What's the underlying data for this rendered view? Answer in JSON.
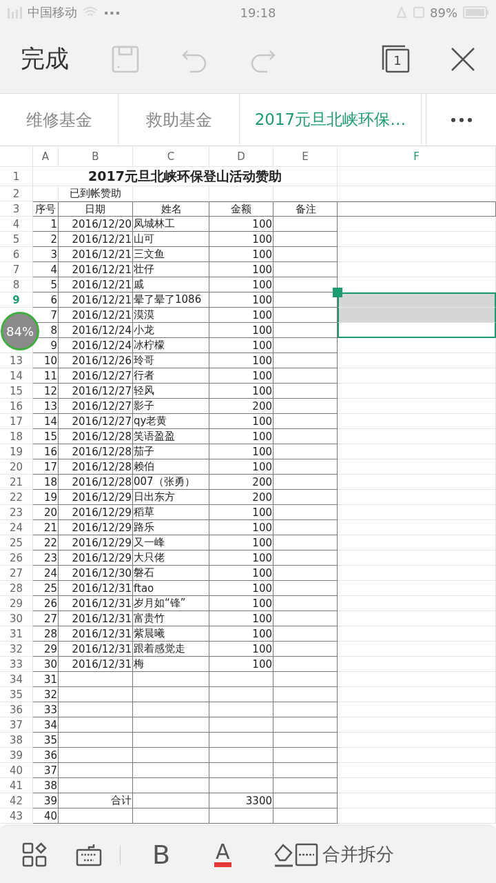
{
  "status_bar": {
    "carrier": "中国移动",
    "extra": "···",
    "time": "19:18",
    "battery": "89%"
  },
  "toolbar": {
    "done": "完成",
    "sheet_count": "1"
  },
  "sheet_tabs": [
    {
      "label": "维修基金",
      "selected": false
    },
    {
      "label": "救助基金",
      "selected": false
    },
    {
      "label": "2017元旦北峡环保…",
      "selected": true
    }
  ],
  "grid": {
    "columns": [
      {
        "label": "A",
        "selected": false
      },
      {
        "label": "B",
        "selected": false
      },
      {
        "label": "C",
        "selected": false
      },
      {
        "label": "D",
        "selected": false
      },
      {
        "label": "E",
        "selected": false
      },
      {
        "label": "F",
        "selected": true
      }
    ],
    "rows": [
      {
        "number": "1",
        "kind": "title",
        "selected": false,
        "in_selection": false,
        "title": "2017元旦北峡环保登山活动赞助"
      },
      {
        "number": "2",
        "kind": "note",
        "selected": false,
        "in_selection": false,
        "b": "已到帐赞助"
      },
      {
        "number": "3",
        "kind": "header",
        "selected": false,
        "in_selection": false,
        "a": "序号",
        "b": "日期",
        "c": "姓名",
        "d": "金额",
        "e": "备注"
      },
      {
        "number": "4",
        "kind": "data",
        "selected": false,
        "in_selection": false,
        "a": "1",
        "b": "2016/12/20",
        "c": "凤城林工",
        "d": "100"
      },
      {
        "number": "5",
        "kind": "data",
        "selected": false,
        "in_selection": false,
        "a": "2",
        "b": "2016/12/21",
        "c": "山可",
        "d": "100"
      },
      {
        "number": "6",
        "kind": "data",
        "selected": false,
        "in_selection": false,
        "a": "3",
        "b": "2016/12/21",
        "c": "三文鱼",
        "d": "100"
      },
      {
        "number": "7",
        "kind": "data",
        "selected": false,
        "in_selection": false,
        "a": "4",
        "b": "2016/12/21",
        "c": "壮仔",
        "d": "100"
      },
      {
        "number": "8",
        "kind": "data",
        "selected": false,
        "in_selection": false,
        "a": "5",
        "b": "2016/12/21",
        "c": "戚",
        "d": "100"
      },
      {
        "number": "9",
        "kind": "data",
        "selected": true,
        "in_selection": true,
        "a": "6",
        "b": "2016/12/21",
        "c": "晕了晕了1086",
        "d": "100"
      },
      {
        "kind": "data",
        "in_selection": true,
        "a": "7",
        "b": "2016/12/21",
        "c": "漠漠",
        "d": "100"
      },
      {
        "kind": "data",
        "in_selection": true,
        "a": "8",
        "b": "2016/12/24",
        "c": "小龙",
        "d": "100"
      },
      {
        "kind": "data",
        "in_selection": false,
        "a": "9",
        "b": "2016/12/24",
        "c": "冰柠檬",
        "d": "100"
      },
      {
        "number": "13",
        "kind": "data",
        "selected": false,
        "in_selection": false,
        "a": "10",
        "b": "2016/12/26",
        "c": "玲哥",
        "d": "100"
      },
      {
        "number": "14",
        "kind": "data",
        "selected": false,
        "in_selection": false,
        "a": "11",
        "b": "2016/12/27",
        "c": "行者",
        "d": "100"
      },
      {
        "number": "15",
        "kind": "data",
        "selected": false,
        "in_selection": false,
        "a": "12",
        "b": "2016/12/27",
        "c": "轻风",
        "d": "100"
      },
      {
        "number": "16",
        "kind": "data",
        "selected": false,
        "in_selection": false,
        "a": "13",
        "b": "2016/12/27",
        "c": "影子",
        "d": "200"
      },
      {
        "number": "17",
        "kind": "data",
        "selected": false,
        "in_selection": false,
        "a": "14",
        "b": "2016/12/27",
        "c": "qy老黄",
        "d": "100"
      },
      {
        "number": "18",
        "kind": "data",
        "selected": false,
        "in_selection": false,
        "a": "15",
        "b": "2016/12/28",
        "c": "笑语盈盈",
        "d": "100"
      },
      {
        "number": "19",
        "kind": "data",
        "selected": false,
        "in_selection": false,
        "a": "16",
        "b": "2016/12/28",
        "c": "茄子",
        "d": "100"
      },
      {
        "number": "20",
        "kind": "data",
        "selected": false,
        "in_selection": false,
        "a": "17",
        "b": "2016/12/28",
        "c": "赖伯",
        "d": "100"
      },
      {
        "number": "21",
        "kind": "data",
        "selected": false,
        "in_selection": false,
        "a": "18",
        "b": "2016/12/28",
        "c": "007（张勇）",
        "d": "200"
      },
      {
        "number": "22",
        "kind": "data",
        "selected": false,
        "in_selection": false,
        "a": "19",
        "b": "2016/12/29",
        "c": "日出东方",
        "d": "200"
      },
      {
        "number": "23",
        "kind": "data",
        "selected": false,
        "in_selection": false,
        "a": "20",
        "b": "2016/12/29",
        "c": "稻草",
        "d": "100"
      },
      {
        "number": "24",
        "kind": "data",
        "selected": false,
        "in_selection": false,
        "a": "21",
        "b": "2016/12/29",
        "c": "路乐",
        "d": "100"
      },
      {
        "number": "25",
        "kind": "data",
        "selected": false,
        "in_selection": false,
        "a": "22",
        "b": "2016/12/29",
        "c": "又一峰",
        "d": "100"
      },
      {
        "number": "26",
        "kind": "data",
        "selected": false,
        "in_selection": false,
        "a": "23",
        "b": "2016/12/29",
        "c": "大只佬",
        "d": "100"
      },
      {
        "number": "27",
        "kind": "data",
        "selected": false,
        "in_selection": false,
        "a": "24",
        "b": "2016/12/30",
        "c": "磐石",
        "d": "100"
      },
      {
        "number": "28",
        "kind": "data",
        "selected": false,
        "in_selection": false,
        "a": "25",
        "b": "2016/12/31",
        "c": "ftao",
        "d": "100"
      },
      {
        "number": "29",
        "kind": "data",
        "selected": false,
        "in_selection": false,
        "a": "26",
        "b": "2016/12/31",
        "c": "岁月如“锋”",
        "d": "100"
      },
      {
        "number": "30",
        "kind": "data",
        "selected": false,
        "in_selection": false,
        "a": "27",
        "b": "2016/12/31",
        "c": "富贵竹",
        "d": "100"
      },
      {
        "number": "31",
        "kind": "data",
        "selected": false,
        "in_selection": false,
        "a": "28",
        "b": "2016/12/31",
        "c": "紫晨曦",
        "d": "100"
      },
      {
        "number": "32",
        "kind": "data",
        "selected": false,
        "in_selection": false,
        "a": "29",
        "b": "2016/12/31",
        "c": "跟着感觉走",
        "d": "100"
      },
      {
        "number": "33",
        "kind": "data",
        "selected": false,
        "in_selection": false,
        "a": "30",
        "b": "2016/12/31",
        "c": "梅",
        "d": "100"
      },
      {
        "number": "34",
        "kind": "data",
        "selected": false,
        "in_selection": false,
        "a": "31"
      },
      {
        "number": "35",
        "kind": "data",
        "selected": false,
        "in_selection": false,
        "a": "32"
      },
      {
        "number": "36",
        "kind": "data",
        "selected": false,
        "in_selection": false,
        "a": "33"
      },
      {
        "number": "37",
        "kind": "data",
        "selected": false,
        "in_selection": false,
        "a": "34"
      },
      {
        "number": "38",
        "kind": "data",
        "selected": false,
        "in_selection": false,
        "a": "35"
      },
      {
        "number": "39",
        "kind": "data",
        "selected": false,
        "in_selection": false,
        "a": "36"
      },
      {
        "number": "40",
        "kind": "data",
        "selected": false,
        "in_selection": false,
        "a": "37"
      },
      {
        "number": "41",
        "kind": "data",
        "selected": false,
        "in_selection": false,
        "a": "38"
      },
      {
        "number": "42",
        "kind": "data",
        "selected": false,
        "in_selection": false,
        "a": "39",
        "b": "合计",
        "d": "3300"
      },
      {
        "number": "43",
        "kind": "data",
        "selected": false,
        "in_selection": false,
        "a": "40"
      }
    ]
  },
  "zoom_badge": "84%",
  "bottom_toolbar": {
    "bold": "B",
    "font_color": "A",
    "merge": "合并拆分"
  }
}
